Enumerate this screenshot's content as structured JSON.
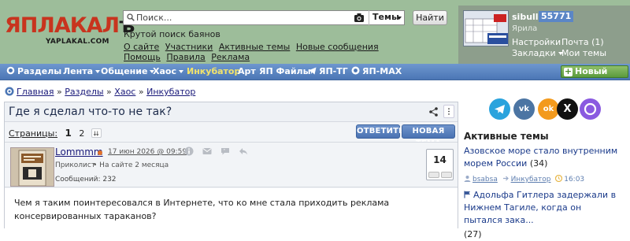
{
  "logo": {
    "main_ya": "Я",
    "main_rest": "ПЛАКАЛ",
    "suffix": "ъ",
    "sub": "YAPLAKAL.COM"
  },
  "search": {
    "placeholder": "Поиск...",
    "scope": "Темы",
    "button": "Найти"
  },
  "tagline": "Крутой поиск баянов",
  "header_links": [
    "О сайте",
    "Участники",
    "Активные темы",
    "Новые сообщения",
    "Помощь",
    "Правила",
    "Реклама"
  ],
  "user": {
    "name": "sibull",
    "score": "55771",
    "city": "Ярила",
    "links": {
      "settings": "Настройки",
      "mail": "Почта (1)",
      "bookmarks": "Закладки",
      "my_topics": "Мои темы"
    }
  },
  "nav": {
    "items": [
      {
        "label": "Разделы"
      },
      {
        "label": "Лента"
      },
      {
        "label": "Общение"
      },
      {
        "label": "Хаос"
      },
      {
        "label": "Инкубатор"
      },
      {
        "label": "Арт"
      },
      {
        "label": "ЯП Файлы"
      },
      {
        "label": "ЯП-ТГ"
      },
      {
        "label": "ЯП-MAX"
      }
    ],
    "new_post": "Новый пост"
  },
  "breadcrumb": [
    "Главная",
    "Разделы",
    "Хаос",
    "Инкубатор"
  ],
  "post": {
    "title": "Где я сделал что-то не так?",
    "pages_label": "Страницы:",
    "current_page": "1",
    "other_page": "2",
    "reply_button": "ОТВЕТИТЬ",
    "new_topic_button": "НОВАЯ ТЕМА",
    "author": "Lommmm",
    "date": "17 июн 2026 @ 09:59",
    "rank": "Приколист",
    "on_site": "На сайте 2 месяца",
    "messages": "Сообщений: 232",
    "rating": "14",
    "text": "Чем я таким поинтересовался в Интернете, что ко мне стала приходить реклама консервированных тараканов?"
  },
  "sidebar": {
    "social": [
      {
        "name": "telegram-icon",
        "glyph": "",
        "color": "#2aa3dd"
      },
      {
        "name": "vk-icon",
        "glyph": "vk",
        "color": "#4c75a3"
      },
      {
        "name": "ok-icon",
        "glyph": "ok",
        "color": "#f39a1d"
      },
      {
        "name": "x-icon",
        "glyph": "X",
        "color": "#111111"
      },
      {
        "name": "max-icon",
        "glyph": "",
        "color": "#8a5ae0"
      }
    ],
    "active_title": "Активные темы",
    "topics": [
      {
        "title": "Азовское море стало внутренним морем России",
        "count": "(34)",
        "author": "bsabsa",
        "section": "Инкубатор",
        "time": "16:03"
      },
      {
        "title": "Адольфа Гитлера задержали в Нижнем Тагиле, когда он пытался зака...",
        "count": "(27)"
      }
    ]
  },
  "colors": {
    "header_bg": "#9dbd9a",
    "nav_bg": "#5b84c2",
    "highlight_nav": "#f2e36a",
    "accent_blue": "#4a72b2",
    "score_badge": "#5b86c6"
  }
}
